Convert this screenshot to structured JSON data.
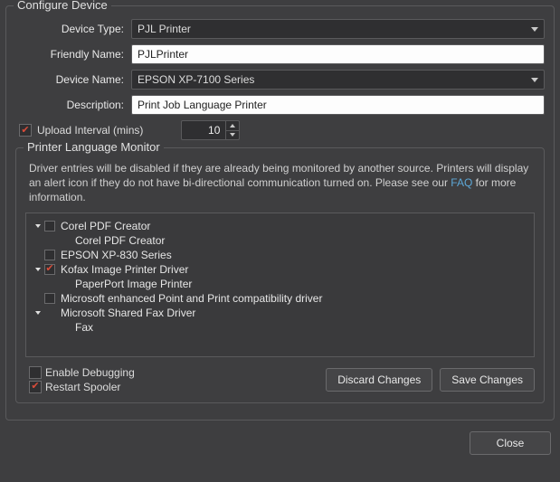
{
  "configure": {
    "title": "Configure Device",
    "labels": {
      "device_type": "Device Type:",
      "friendly_name": "Friendly Name:",
      "device_name": "Device Name:",
      "description": "Description:",
      "upload_interval": "Upload Interval (mins)"
    },
    "values": {
      "device_type": "PJL Printer",
      "friendly_name": "PJLPrinter",
      "device_name": "EPSON XP-7100 Series",
      "description": "Print Job Language Printer",
      "upload_interval": "10"
    }
  },
  "monitor": {
    "title": "Printer Language Monitor",
    "info_pre": "Driver entries will be disabled if they are already being monitored by another source. Printers will display an alert icon if they do not have bi-directional communication turned on. Please see our ",
    "faq": "FAQ",
    "info_post": " for more information.",
    "tree": [
      {
        "level": 0,
        "expander": true,
        "checkbox": true,
        "checked": false,
        "label": "Corel PDF Creator"
      },
      {
        "level": 1,
        "expander": false,
        "checkbox": false,
        "checked": false,
        "label": "Corel PDF Creator"
      },
      {
        "level": 0,
        "expander": false,
        "checkbox": true,
        "checked": false,
        "label": "EPSON XP-830 Series"
      },
      {
        "level": 0,
        "expander": true,
        "checkbox": true,
        "checked": true,
        "label": "Kofax Image Printer Driver"
      },
      {
        "level": 1,
        "expander": false,
        "checkbox": false,
        "checked": false,
        "label": "PaperPort Image Printer"
      },
      {
        "level": 0,
        "expander": false,
        "checkbox": true,
        "checked": false,
        "label": "Microsoft enhanced Point and Print compatibility driver"
      },
      {
        "level": 0,
        "expander": true,
        "checkbox": false,
        "checked": false,
        "label": "Microsoft Shared Fax Driver"
      },
      {
        "level": 1,
        "expander": false,
        "checkbox": false,
        "checked": false,
        "label": "Fax"
      }
    ],
    "enable_debugging": "Enable Debugging",
    "restart_spooler": "Restart Spooler",
    "discard": "Discard Changes",
    "save": "Save Changes"
  },
  "footer": {
    "close": "Close"
  }
}
